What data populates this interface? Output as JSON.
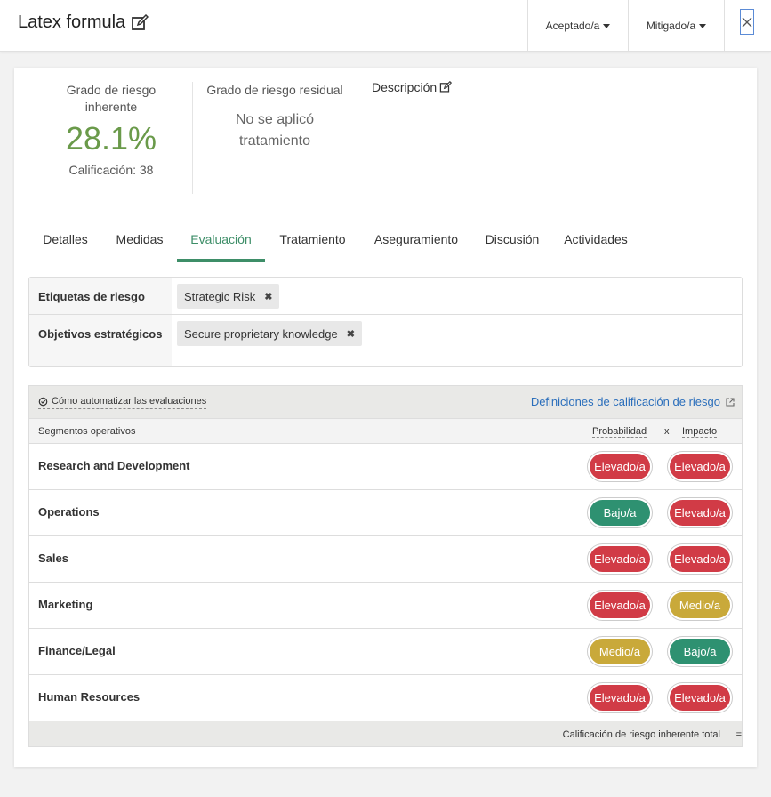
{
  "header": {
    "title": "Latex formula",
    "accepted_label": "Aceptado/a",
    "mitigated_label": "Mitigado/a"
  },
  "summary": {
    "inherent_label": "Grado de riesgo inherente",
    "inherent_value": "28.1%",
    "inherent_score": "Calificación: 38",
    "residual_label": "Grado de riesgo residual",
    "residual_value": "No se aplicó tratamiento",
    "description_label": "Descripción"
  },
  "tabs": [
    {
      "label": "Detalles"
    },
    {
      "label": "Medidas"
    },
    {
      "label": "Evaluación"
    },
    {
      "label": "Tratamiento"
    },
    {
      "label": "Aseguramiento"
    },
    {
      "label": "Discusión"
    },
    {
      "label": "Actividades"
    }
  ],
  "active_tab": "Evaluación",
  "labels": {
    "risk_tags_label": "Etiquetas de riesgo",
    "risk_tags": [
      "Strategic Risk"
    ],
    "objectives_label": "Objetivos estratégicos",
    "objectives": [
      "Secure proprietary knowledge"
    ]
  },
  "assessment": {
    "automate_link": "Cómo automatizar las evaluaciones",
    "definitions_link": "Definiciones de calificación de riesgo",
    "col_segments": "Segmentos operativos",
    "col_probability": "Probabilidad",
    "col_x": "x",
    "col_impact": "Impacto",
    "footer_label": "Calificación de riesgo inherente total",
    "footer_eq": "=",
    "rows": [
      {
        "name": "Research and Development",
        "probability": "Elevado/a",
        "impact": "Elevado/a"
      },
      {
        "name": "Operations",
        "probability": "Bajo/a",
        "impact": "Elevado/a"
      },
      {
        "name": "Sales",
        "probability": "Elevado/a",
        "impact": "Elevado/a"
      },
      {
        "name": "Marketing",
        "probability": "Elevado/a",
        "impact": "Medio/a"
      },
      {
        "name": "Finance/Legal",
        "probability": "Medio/a",
        "impact": "Bajo/a"
      },
      {
        "name": "Human Resources",
        "probability": "Elevado/a",
        "impact": "Elevado/a"
      }
    ]
  },
  "colors": {
    "accent": "#3e8e68",
    "elevado": "#d13b46",
    "medio": "#c9a93a",
    "bajo": "#2e9171",
    "link": "#2a6ebb"
  }
}
